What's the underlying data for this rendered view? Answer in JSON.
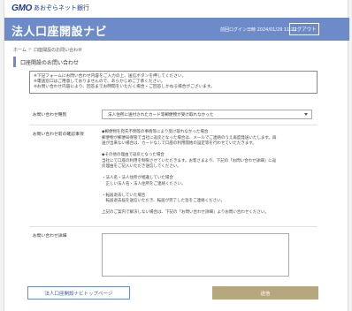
{
  "brand": {
    "gmo": "GMO",
    "bank": "あおぞらネット銀行"
  },
  "header": {
    "title": "法人口座開設ナビ",
    "last_login": "前回ログイン日時 2024/01/29 11:22",
    "logout_label": "ログアウト"
  },
  "breadcrumb": {
    "home": "ホーム",
    "sep": ">",
    "current": "口座開設のお問い合わせ"
  },
  "section_title": "口座開設のお問い合わせ",
  "notice": [
    "※下記フォームにお問い合わせ内容をご入力の上、送信ボタンを押してください。",
    "※電話窓口はご用意しておりませんので、あらかじめご了承ください。",
    "※お問い合わせ内容により、回答までお時間をいただく場合・ご回答しかねる場合がございます。"
  ],
  "form": {
    "type_label": "お問い合わせ種別",
    "type_selected": "法人住所に送付されたカード等郵便物が受け取れなかった",
    "info_label": "お問い合わせ前の確認事項",
    "info_lines": [
      "◆郵便物を宛先不明等の事情等により受け取れなかった場合",
      "郵便物が郵便局保管で当社に返戻となった場合は、メールでご連絡のうえ再度発送いたします。再",
      "送が出来ない場合は、カードなしで口座の利用開始の設定等を行わせていただきます。",
      "",
      "◆その他の理由で返戻となった場合",
      "当社にて口座の利用を制限させていただきます。お客さまより、下記の「お問い合わせ詳細」に返",
      "戻理由をご記入いただき送信してください。",
      "",
      "・法人名・法人住所が相違していた場合",
      "　正しい法人名・法人住所をご連絡ください。",
      "",
      "・転居退去していた場合",
      "　転居退去届を送信いただき、転居が完了した旨をご連絡ください。",
      "",
      "上記のご案内で解決しない場合は、下記の「お問い合わせ詳細」よりお問い合わせください。"
    ],
    "detail_label": "お問い合わせ詳細"
  },
  "buttons": {
    "top_page": "法人口座開設ナビトップページ",
    "send": "送信"
  }
}
